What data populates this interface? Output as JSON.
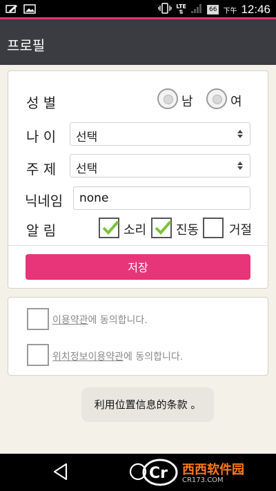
{
  "status_bar": {
    "battery": "66",
    "network": "LTE",
    "ampm": "下午",
    "time": "12:46"
  },
  "app_bar": {
    "title": "프로필"
  },
  "form": {
    "gender_label": "성 별",
    "gender_options": [
      "남",
      "여"
    ],
    "age_label": "나 이",
    "age_value": "선택",
    "topic_label": "주 제",
    "topic_value": "선택",
    "nickname_label": "닉네임",
    "nickname_value": "none",
    "alarm_label": "알 림",
    "alarm_options": [
      {
        "label": "소리",
        "checked": true
      },
      {
        "label": "진동",
        "checked": true
      },
      {
        "label": "거절",
        "checked": false
      }
    ],
    "save_label": "저장"
  },
  "terms": {
    "items": [
      {
        "link": "이용약관",
        "suffix": "에 동의합니다."
      },
      {
        "link": "위치정보이용약관",
        "suffix": "에 동의합니다."
      }
    ]
  },
  "toast": {
    "text": "利用位置信息的条款 。"
  },
  "watermark": {
    "brand": "西西软件园",
    "url": "CR173.COM",
    "logo_letters": "Cr"
  },
  "colors": {
    "accent": "#e8357a",
    "app_bar": "#3b3b42",
    "background": "#f3f1e8",
    "check_green": "#7cc23a"
  }
}
